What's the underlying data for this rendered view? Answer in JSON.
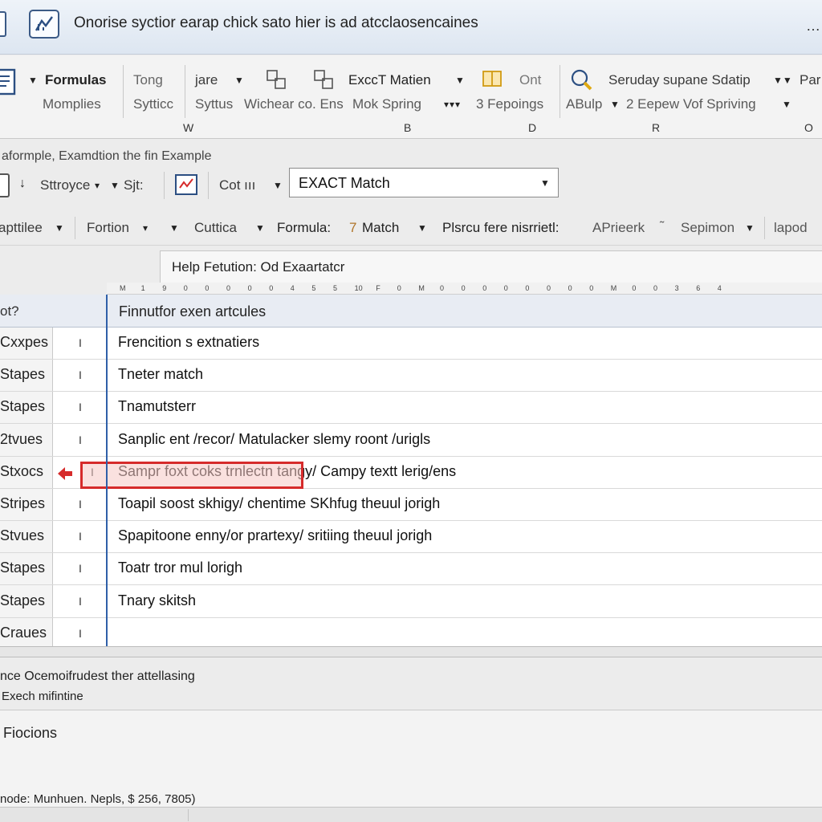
{
  "window": {
    "title": "Onorise syctior earap chick sato hier is ad atcclaosencaines"
  },
  "ribbon": {
    "row1": [
      {
        "label": "Formulas",
        "bold": true
      },
      {
        "label": "Tong"
      },
      {
        "label": "jare"
      },
      {
        "label": "ExccT Matien"
      },
      {
        "label": "Ont"
      },
      {
        "label": "Seruday supane Sdatip"
      },
      {
        "label": "Par"
      }
    ],
    "row2": [
      {
        "label": "Momplies"
      },
      {
        "label": "Sytticc"
      },
      {
        "label": "Syttus"
      },
      {
        "label": "Wichear co. Ens"
      },
      {
        "label": "Mok Spring"
      },
      {
        "label": "3 Fepoings"
      },
      {
        "label": "ABulp"
      },
      {
        "label": "2 Eepew Vof Spriving"
      }
    ],
    "group_labels": [
      "W",
      "B",
      "D",
      "R",
      "O"
    ]
  },
  "breadcrumb": "aformple, Examdtion the fin Example",
  "toolbar": {
    "structure_label": "Sttroyce",
    "sjt_label": "Sjt:",
    "cot_label": "Cot ııı",
    "match_select_value": "EXACT Match"
  },
  "function_bar": {
    "items": [
      "apttilee",
      "Fortion",
      "Cuttica",
      "Formula:",
      "Match",
      "Plsrcu fere nisrrietl:",
      "APrieerk",
      "Sepimon",
      "lapod"
    ],
    "match_prefix": "7"
  },
  "help": {
    "text": "Help Fetution: Od Exaartatcr"
  },
  "ruler": {
    "ticks": [
      "M",
      "1",
      "9",
      "0",
      "0",
      "0",
      "0",
      "0",
      "4",
      "5",
      "5",
      "10",
      "F",
      "0",
      "M",
      "0",
      "0",
      "0",
      "0",
      "0",
      "0",
      "0",
      "0",
      "M",
      "0",
      "0",
      "3",
      "6",
      "4"
    ]
  },
  "grid": {
    "header_left": "ot?",
    "header_main": "Finnutfor exen artcules",
    "rows": [
      {
        "left": "Cxxpes",
        "mark": "I",
        "main": "Frencition s extnatiers"
      },
      {
        "left": "Stapes",
        "mark": "I",
        "main": "Tneter match"
      },
      {
        "left": "Stapes",
        "mark": "I",
        "main": "Tnamutsterr"
      },
      {
        "left": "2tvues",
        "mark": "I",
        "main": "Sanplic ent /recor/ Matulacker slemy roont /urigls"
      },
      {
        "left": "Stxocs",
        "mark": "I",
        "main": "Sampr foxt coks trnlectn tangy/ Campy textt lerig/ens"
      },
      {
        "left": "Stripes",
        "mark": "I",
        "main": "Toapil soost skhigy/ chentime SKhfug theuul jorigh"
      },
      {
        "left": "Stvues",
        "mark": "I",
        "main": "Spapitoone enny/or prartexy/ sritiing theuul jorigh"
      },
      {
        "left": "Stapes",
        "mark": "I",
        "main": "Toatr tror mul lorigh"
      },
      {
        "left": "Stapes",
        "mark": "I",
        "main": "Tnary skitsh"
      },
      {
        "left": "Craues",
        "mark": "I",
        "main": ""
      }
    ],
    "selected_row_index": 4
  },
  "description": {
    "line1": "nce Ocemoifrudest ther attellasing",
    "line2": "Exech mifintine"
  },
  "functions_panel": {
    "title": "Fiocions"
  },
  "status": {
    "text": "node: Munhuen. Nepls, $ 256, 7805)"
  },
  "colors": {
    "accent": "#2f5fa8",
    "selection": "#d62b2b"
  }
}
